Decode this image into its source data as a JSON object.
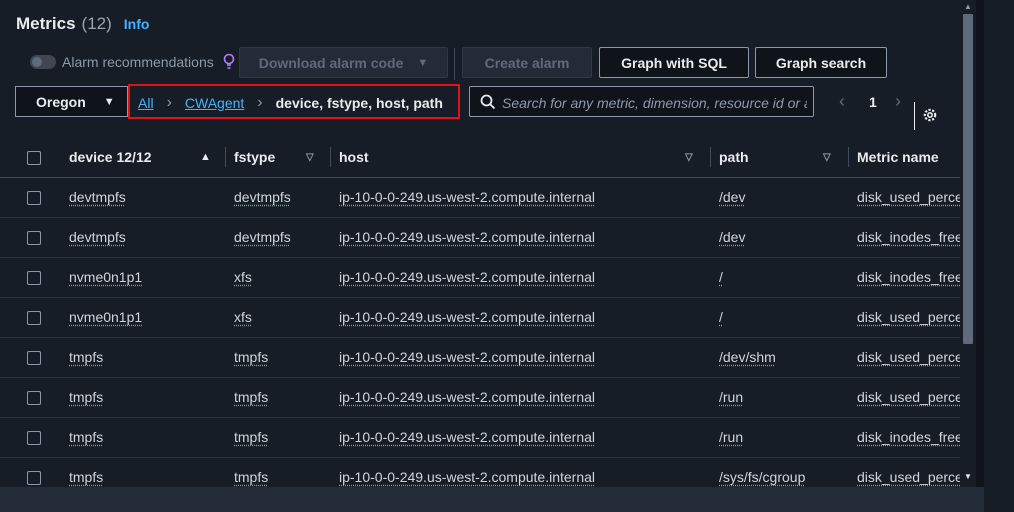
{
  "header": {
    "title": "Metrics",
    "count": "(12)",
    "info": "Info"
  },
  "toolbar": {
    "alarm_recommendations": "Alarm recommendations",
    "download_alarm_code": "Download alarm code",
    "create_alarm": "Create alarm",
    "graph_with_sql": "Graph with SQL",
    "graph_search": "Graph search"
  },
  "region": {
    "value": "Oregon"
  },
  "breadcrumb": {
    "all": "All",
    "namespace": "CWAgent",
    "current": "device, fstype, host, path"
  },
  "search": {
    "placeholder": "Search for any metric, dimension, resource id or a"
  },
  "pagination": {
    "page": "1"
  },
  "table": {
    "columns": [
      "device 12/12",
      "fstype",
      "host",
      "path",
      "Metric name"
    ],
    "rows": [
      {
        "device": "devtmpfs",
        "fstype": "devtmpfs",
        "host": "ip-10-0-0-249.us-west-2.compute.internal",
        "path": "/dev",
        "metric": "disk_used_percent"
      },
      {
        "device": "devtmpfs",
        "fstype": "devtmpfs",
        "host": "ip-10-0-0-249.us-west-2.compute.internal",
        "path": "/dev",
        "metric": "disk_inodes_free"
      },
      {
        "device": "nvme0n1p1",
        "fstype": "xfs",
        "host": "ip-10-0-0-249.us-west-2.compute.internal",
        "path": "/",
        "metric": "disk_inodes_free"
      },
      {
        "device": "nvme0n1p1",
        "fstype": "xfs",
        "host": "ip-10-0-0-249.us-west-2.compute.internal",
        "path": "/",
        "metric": "disk_used_percent"
      },
      {
        "device": "tmpfs",
        "fstype": "tmpfs",
        "host": "ip-10-0-0-249.us-west-2.compute.internal",
        "path": "/dev/shm",
        "metric": "disk_used_percent"
      },
      {
        "device": "tmpfs",
        "fstype": "tmpfs",
        "host": "ip-10-0-0-249.us-west-2.compute.internal",
        "path": "/run",
        "metric": "disk_used_percent"
      },
      {
        "device": "tmpfs",
        "fstype": "tmpfs",
        "host": "ip-10-0-0-249.us-west-2.compute.internal",
        "path": "/run",
        "metric": "disk_inodes_free"
      },
      {
        "device": "tmpfs",
        "fstype": "tmpfs",
        "host": "ip-10-0-0-249.us-west-2.compute.internal",
        "path": "/sys/fs/cgroup",
        "metric": "disk_used_percent"
      }
    ]
  },
  "colors": {
    "accent": "#42b4ff",
    "highlight_border": "#e0131a",
    "background": "#161d26"
  }
}
